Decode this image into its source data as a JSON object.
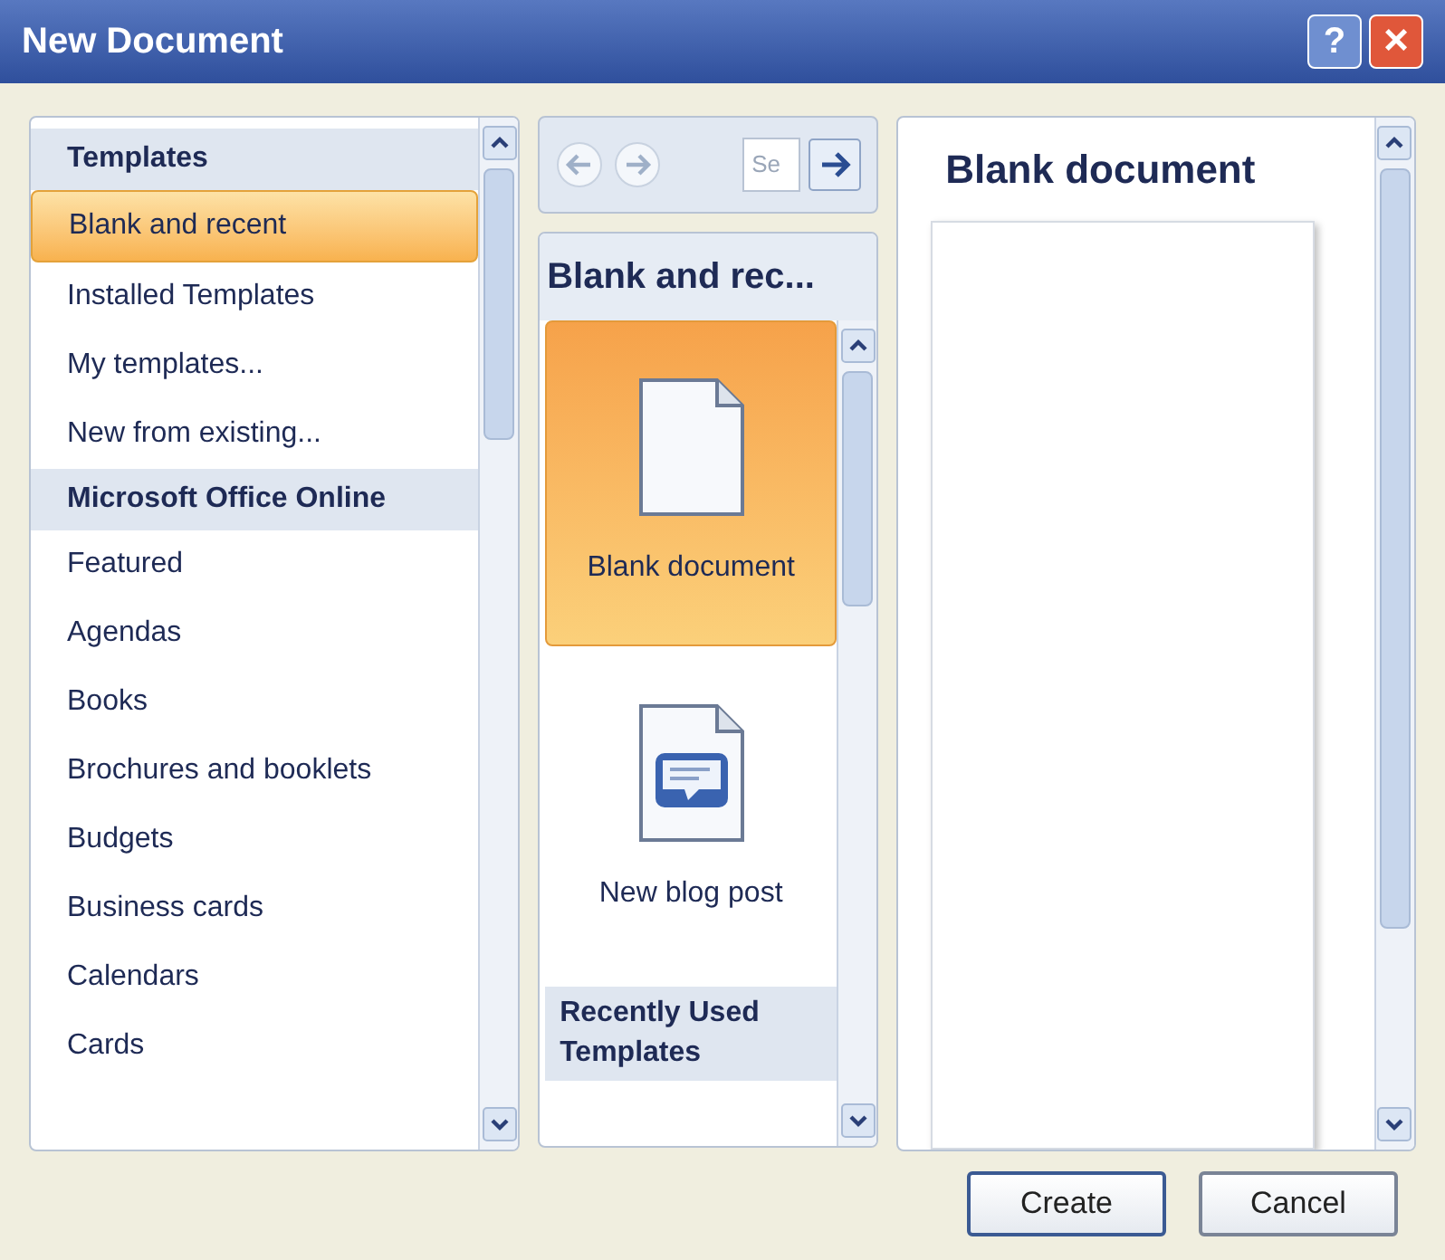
{
  "window": {
    "title": "New Document",
    "help": "?",
    "close": "×"
  },
  "categories": [
    {
      "kind": "header",
      "label": "Templates"
    },
    {
      "kind": "item",
      "label": "Blank and recent",
      "selected": true
    },
    {
      "kind": "item",
      "label": "Installed Templates",
      "selected": false
    },
    {
      "kind": "item",
      "label": "My templates...",
      "selected": false
    },
    {
      "kind": "item",
      "label": "New from existing...",
      "selected": false
    },
    {
      "kind": "header",
      "label": "Microsoft Office Online"
    },
    {
      "kind": "item",
      "label": "Featured",
      "selected": false
    },
    {
      "kind": "item",
      "label": "Agendas",
      "selected": false
    },
    {
      "kind": "item",
      "label": "Books",
      "selected": false
    },
    {
      "kind": "item",
      "label": "Brochures and booklets",
      "selected": false
    },
    {
      "kind": "item",
      "label": "Budgets",
      "selected": false
    },
    {
      "kind": "item",
      "label": "Business cards",
      "selected": false
    },
    {
      "kind": "item",
      "label": "Calendars",
      "selected": false
    },
    {
      "kind": "item",
      "label": "Cards",
      "selected": false
    }
  ],
  "search": {
    "placeholder": "Se"
  },
  "gallery": {
    "title": "Blank and rec...",
    "items": [
      {
        "kind": "blank",
        "label": "Blank document",
        "selected": true
      },
      {
        "kind": "blog",
        "label": "New blog post",
        "selected": false
      }
    ],
    "section": "Recently Used Templates"
  },
  "preview": {
    "title": "Blank document"
  },
  "buttons": [
    "Create",
    "Cancel"
  ]
}
